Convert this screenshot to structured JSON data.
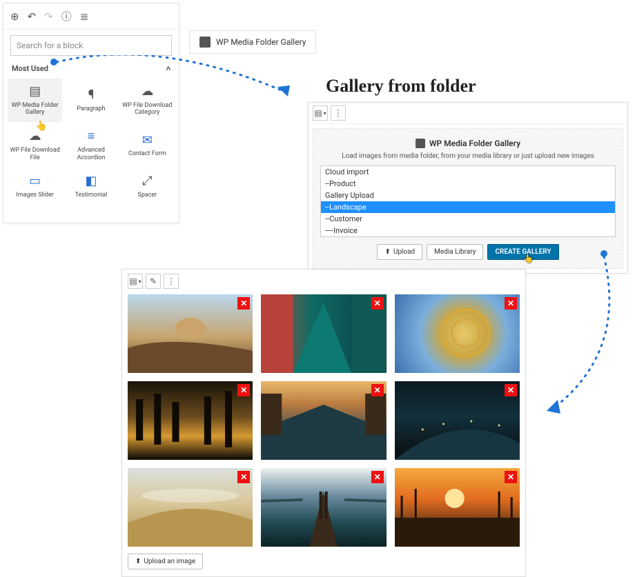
{
  "inserter": {
    "search_placeholder": "Search for a block",
    "section_label": "Most Used",
    "items": [
      {
        "label": "WP Media Folder Gallery"
      },
      {
        "label": "Paragraph"
      },
      {
        "label": "WP File Download Category"
      },
      {
        "label": "WP File Download File"
      },
      {
        "label": "Advanced Accordion"
      },
      {
        "label": "Contact Form"
      },
      {
        "label": "Images Slider"
      },
      {
        "label": "Testimonial"
      },
      {
        "label": "Spacer"
      }
    ]
  },
  "selected_block_chip": "WP Media Folder Gallery",
  "gff": {
    "heading": "Gallery from folder",
    "panel_title": "WP Media Folder Gallery",
    "helper": "Load images from media folder, from your media library or just upload new images",
    "folders": [
      "Cloud import",
      "--Product",
      "Gallery Upload",
      "--Landscape",
      "--Customer",
      "----Invoice"
    ],
    "selected_folder_index": 3,
    "upload_label": "Upload",
    "media_library_label": "Media Library",
    "create_label": "CREATE GALLERY"
  },
  "gallery": {
    "upload_label": "Upload an image",
    "delete_glyph": "✕"
  }
}
